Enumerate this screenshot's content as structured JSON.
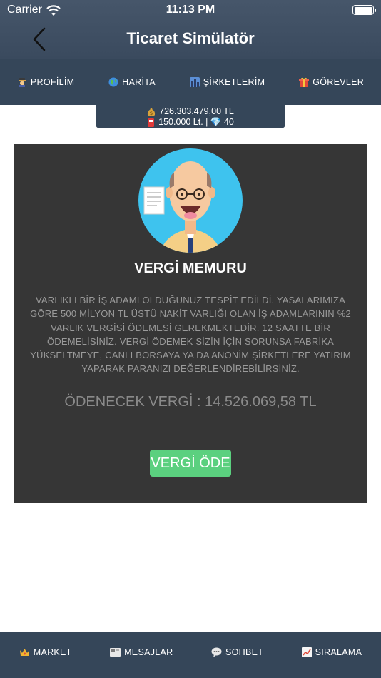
{
  "status_bar": {
    "carrier": "Carrier",
    "time": "11:13 PM"
  },
  "nav": {
    "title": "Ticaret Simülatör"
  },
  "tabs": [
    {
      "label": "PROFİLİM",
      "icon": "guard-icon"
    },
    {
      "label": "HARİTA",
      "icon": "globe-icon"
    },
    {
      "label": "ŞİRKETLERİM",
      "icon": "city-icon"
    },
    {
      "label": "GÖREVLER",
      "icon": "gift-icon"
    }
  ],
  "stats": {
    "money": "726.303.479,00 TL",
    "fuel_diamond": "150.000 Lt. | 💎 40"
  },
  "card": {
    "title": "VERGİ MEMURU",
    "description": "VARLIKLI BİR İŞ ADAMI OLDUĞUNUZ TESPİT EDİLDİ. YASALARIMIZA GÖRE 500 MİLYON TL ÜSTÜ NAKİT VARLIĞI OLAN İŞ ADAMLARININ %2 VARLIK VERGİSİ ÖDEMESİ GEREKMEKTEDİR. 12 SAATTE BİR ÖDEMELİSİNİZ. VERGİ ÖDEMEK SİZİN İÇİN SORUNSA FABRİKA YÜKSELTMEYE, CANLI BORSAYA YA DA ANONİM ŞİRKETLERE YATIRIM YAPARAK PARANIZI DEĞERLENDİREBİLİRSİNİZ.",
    "tax_line": "ÖDENECEK VERGİ : 14.526.069,58 TL",
    "pay_button": "VERGİ ÖDE"
  },
  "bottom_tabs": [
    {
      "label": "MARKET",
      "icon": "crown-icon"
    },
    {
      "label": "MESAJLAR",
      "icon": "newspaper-icon"
    },
    {
      "label": "SOHBET",
      "icon": "speech-bubble-icon"
    },
    {
      "label": "SIRALAMA",
      "icon": "chart-icon"
    }
  ],
  "colors": {
    "nav_bg": "#354659",
    "card_bg": "#363636",
    "pay_button": "#5bd07f",
    "avatar_bg": "#3ec3ee"
  }
}
